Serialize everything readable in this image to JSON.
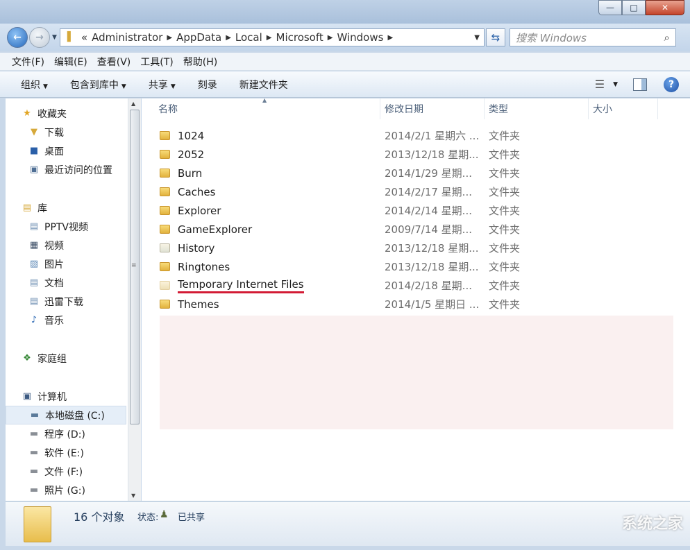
{
  "navigation": {
    "breadcrumbs": [
      "Administrator",
      "AppData",
      "Local",
      "Microsoft",
      "Windows"
    ],
    "overflow": "«",
    "search_placeholder": "搜索 Windows"
  },
  "menubar": [
    "文件(F)",
    "编辑(E)",
    "查看(V)",
    "工具(T)",
    "帮助(H)"
  ],
  "commands": {
    "organize": "组织",
    "include_library": "包含到库中",
    "share": "共享",
    "burn": "刻录",
    "new_folder": "新建文件夹"
  },
  "sidebar": {
    "favorites": {
      "label": "收藏夹",
      "items": [
        "下载",
        "桌面",
        "最近访问的位置"
      ]
    },
    "libraries": {
      "label": "库",
      "items": [
        "PPTV视频",
        "视频",
        "图片",
        "文档",
        "迅雷下载",
        "音乐"
      ]
    },
    "homegroup": {
      "label": "家庭组"
    },
    "computer": {
      "label": "计算机",
      "items": [
        "本地磁盘 (C:)",
        "程序 (D:)",
        "软件 (E:)",
        "文件 (F:)",
        "照片 (G:)"
      ],
      "selected": "本地磁盘 (C:)"
    }
  },
  "columns": {
    "name": "名称",
    "date": "修改日期",
    "type": "类型",
    "size": "大小"
  },
  "files": [
    {
      "name": "1024",
      "date": "2014/2/1 星期六 ...",
      "type": "文件夹"
    },
    {
      "name": "2052",
      "date": "2013/12/18 星期...",
      "type": "文件夹"
    },
    {
      "name": "Burn",
      "date": "2014/1/29 星期...",
      "type": "文件夹"
    },
    {
      "name": "Caches",
      "date": "2014/2/17 星期...",
      "type": "文件夹"
    },
    {
      "name": "Explorer",
      "date": "2014/2/14 星期...",
      "type": "文件夹"
    },
    {
      "name": "GameExplorer",
      "date": "2009/7/14 星期...",
      "type": "文件夹"
    },
    {
      "name": "History",
      "date": "2013/12/18 星期...",
      "type": "文件夹"
    },
    {
      "name": "Ringtones",
      "date": "2013/12/18 星期...",
      "type": "文件夹"
    },
    {
      "name": "Temporary Internet Files",
      "date": "2014/2/18 星期...",
      "type": "文件夹"
    },
    {
      "name": "Themes",
      "date": "2014/1/5 星期日 ...",
      "type": "文件夹"
    }
  ],
  "status": {
    "count": "16 个对象",
    "state_label": "状态:",
    "state_value": "已共享"
  },
  "watermark": "系统之家",
  "colors": {
    "highlight_underline": "#d31b35",
    "accent": "#2568bb"
  }
}
